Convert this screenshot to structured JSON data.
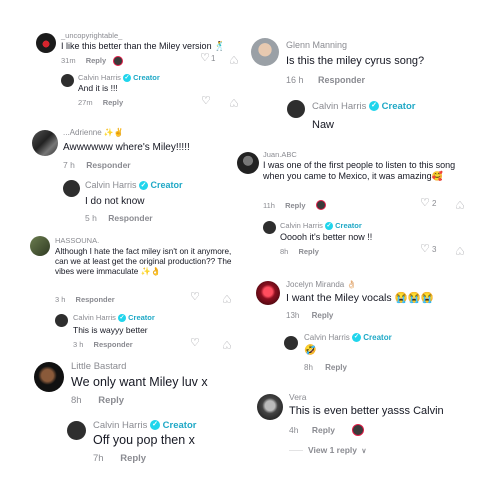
{
  "c1": {
    "username": "_uncopyrightable_",
    "text": "I like this better than the Miley version 🕺",
    "time": "31m",
    "reply": "Reply",
    "likes": "1",
    "reply1": {
      "username": "Calvin Harris",
      "badge": "Creator",
      "text": "And it is !!!",
      "time": "27m",
      "reply": "Reply"
    }
  },
  "c2": {
    "username": "...Adrienne ✨✌️",
    "text": "Awwwwww where's Miley!!!!!",
    "time": "7 h",
    "reply": "Responder",
    "reply1": {
      "username": "Calvin Harris",
      "badge": "Creator",
      "text": "I do not know",
      "time": "5 h",
      "reply": "Responder"
    }
  },
  "c3": {
    "username": "HASSOUNA.",
    "text": "Although I hate the fact miley isn't on it anymore, can we at least get the original production?? The vibes were immaculate ✨👌",
    "time": "3 h",
    "reply": "Responder",
    "reply1": {
      "username": "Calvin Harris",
      "badge": "Creator",
      "text": "This is wayyy better",
      "time": "3 h",
      "reply": "Responder"
    }
  },
  "c4": {
    "username": "Little Bastard",
    "text": "We only want Miley luv x",
    "time": "8h",
    "reply": "Reply",
    "reply1": {
      "username": "Calvin Harris",
      "badge": "Creator",
      "text": "Off you pop then x",
      "time": "7h",
      "reply": "Reply"
    }
  },
  "c5": {
    "username": "Glenn Manning",
    "text": "Is this the miley cyrus song?",
    "time": "16 h",
    "reply": "Responder",
    "reply1": {
      "username": "Calvin Harris",
      "badge": "Creator",
      "text": "Naw"
    }
  },
  "c6": {
    "username": "Juan.ABC",
    "text": "I was one of the first people to listen to this song when you came to Mexico, it was amazing🥰",
    "time": "11h",
    "reply": "Reply",
    "likes": "2",
    "reply1": {
      "username": "Calvin Harris",
      "badge": "Creator",
      "text": "Ooooh it's better now !!",
      "time": "8h",
      "reply": "Reply",
      "likes": "3"
    }
  },
  "c7": {
    "username": "Jocelyn Miranda 👌🏻",
    "text": "I want the Miley vocals 😭😭😭",
    "time": "13h",
    "reply": "Reply",
    "reply1": {
      "username": "Calvin Harris",
      "badge": "Creator",
      "text": "🤣",
      "time": "8h",
      "reply": "Reply"
    }
  },
  "c8": {
    "username": "Vera",
    "text": "This is even better yasss Calvin",
    "time": "4h",
    "reply": "Reply",
    "view_replies": "View 1 reply"
  },
  "icons": {
    "check": "✓",
    "heart": "♡",
    "dislike": "♡",
    "chevron": "∨"
  },
  "colors": {
    "creator": "#1fa8c6",
    "verified": "#20d5ec",
    "text": "#161823",
    "muted": "#8a8b91"
  }
}
